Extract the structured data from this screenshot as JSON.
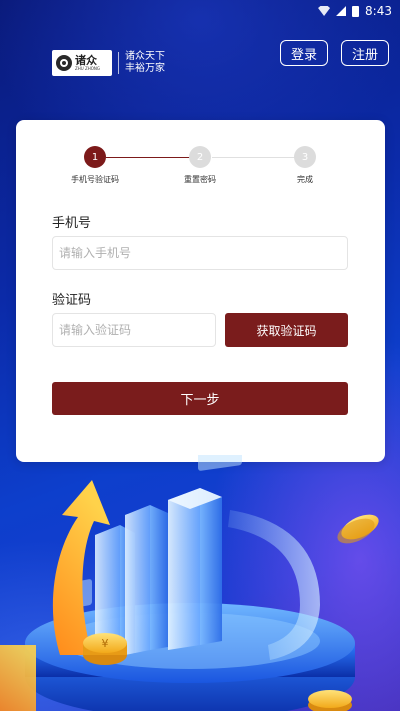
{
  "status_bar": {
    "time": "8:43"
  },
  "logo": {
    "name": "诸众",
    "name_en": "ZHU ZHONG",
    "slogan_line1": "诸众天下",
    "slogan_line2": "丰裕万家"
  },
  "header": {
    "login_label": "登录",
    "register_label": "注册"
  },
  "stepper": {
    "steps": [
      {
        "number": "1",
        "label": "手机号验证码",
        "state": "active"
      },
      {
        "number": "2",
        "label": "重置密码",
        "state": "inactive"
      },
      {
        "number": "3",
        "label": "完成",
        "state": "inactive"
      }
    ]
  },
  "form": {
    "phone_label": "手机号",
    "phone_placeholder": "请输入手机号",
    "phone_value": "",
    "code_label": "验证码",
    "code_placeholder": "请输入验证码",
    "code_value": "",
    "get_code_label": "获取验证码",
    "next_label": "下一步"
  },
  "illustration": {
    "coin_symbol": "¥"
  },
  "colors": {
    "primary": "#7a1c1c",
    "background": "#0b2aa8",
    "step_inactive": "#dcdcdc"
  }
}
